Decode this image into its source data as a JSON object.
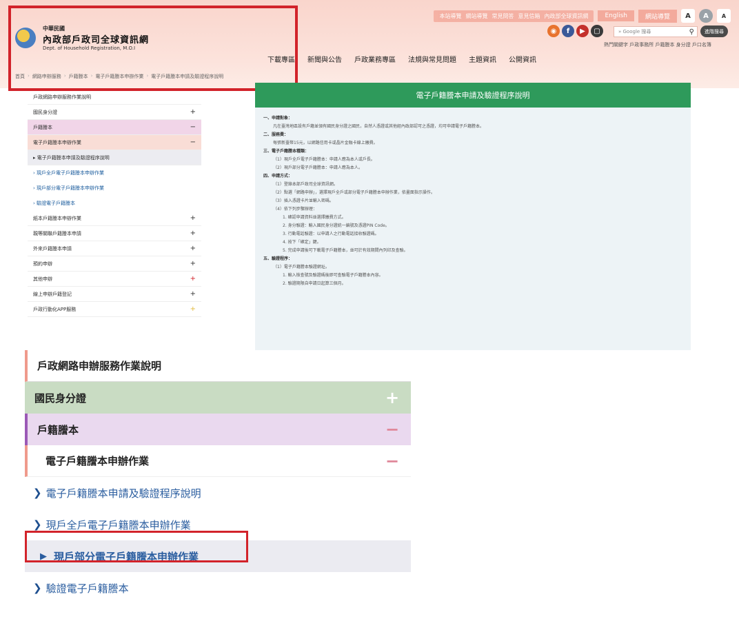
{
  "header": {
    "utility_links": [
      "本站導覽",
      "網站導覽",
      "常見問答",
      "意見信箱",
      "內政部全球資訊網"
    ],
    "lang_label": "English",
    "sitemap_label": "網站導覽",
    "font_sizes": [
      "A",
      "A",
      "A"
    ],
    "social_icons": [
      "rss-icon",
      "facebook-icon",
      "youtube-icon",
      "line-icon"
    ],
    "search_placeholder": "» Google 搜尋",
    "search_button": "進階搜尋",
    "hot_keywords": "熱門關鍵字 戶政事務所 戶籍謄本 身分證 戶口名簿"
  },
  "logo": {
    "line1": "中華民國",
    "line2": "內政部戶政司全球資訊網",
    "line3": "Dept. of Household Registration, M.O.I"
  },
  "main_nav": [
    "下載專區",
    "新聞與公告",
    "戶政業務專區",
    "法規與常見問題",
    "主題資訊",
    "公開資訊"
  ],
  "breadcrumb": [
    "首頁",
    "網路申辦服務",
    "戶籍謄本",
    "電子戶籍謄本申辦作業",
    "電子戶籍謄本申請及驗證程序說明"
  ],
  "sidebar_small": [
    {
      "label": "戶政網路申辦服務作業說明",
      "sign": "",
      "style": "plain"
    },
    {
      "label": "國民身分證",
      "sign": "+",
      "style": "plain"
    },
    {
      "label": "戶籍謄本",
      "sign": "−",
      "style": "pink"
    },
    {
      "label": "電子戶籍謄本申辦作業",
      "sign": "−",
      "style": "salmon"
    },
    {
      "label": "▸ 電子戶籍謄本申請及驗證程序說明",
      "sign": "",
      "style": "grey"
    },
    {
      "label": "› 現戶全戶電子戶籍謄本申辦作業",
      "sign": "",
      "style": "link"
    },
    {
      "label": "› 現戶部分電子戶籍謄本申辦作業",
      "sign": "",
      "style": "link"
    },
    {
      "label": "› 驗證電子戶籍謄本",
      "sign": "",
      "style": "link"
    },
    {
      "label": "紙本戶籍謄本申辦作業",
      "sign": "+",
      "style": "plain"
    },
    {
      "label": "親等關聯戶籍謄本申請",
      "sign": "+",
      "style": "plain"
    },
    {
      "label": "外來戶籍謄本申請",
      "sign": "+",
      "style": "plain"
    },
    {
      "label": "預約申辦",
      "sign": "+",
      "style": "plain"
    },
    {
      "label": "其他申辦",
      "sign": "+",
      "style": "plain"
    },
    {
      "label": "線上申辦戶籍登記",
      "sign": "+",
      "style": "plain"
    },
    {
      "label": "戶政行動化APP服務",
      "sign": "+",
      "style": "plain"
    }
  ],
  "content": {
    "title": "電子戶籍謄本申請及驗證程序說明",
    "lines": [
      {
        "text": "一、申請對象：",
        "level": 0
      },
      {
        "text": "凡在臺灣地區設有戶籍並領有國民身分證之國民，自然人憑證或其他經內政部認可之憑證，均可申請電子戶籍謄本。",
        "level": 1
      },
      {
        "text": "二、服務費：",
        "level": 0
      },
      {
        "text": "每張新臺幣15元，以網路信用卡或晶片金融卡線上繳費。",
        "level": 1
      },
      {
        "text": "三、電子戶籍謄本種類：",
        "level": 0
      },
      {
        "text": "（1）現戶全戶電子戶籍謄本：申請人應為本人或戶長。",
        "level": 1
      },
      {
        "text": "（2）現戶部分電子戶籍謄本：申請人應為本人。",
        "level": 1
      },
      {
        "text": "四、申請方式：",
        "level": 0
      },
      {
        "text": "（1）登錄本部戶政司全球資訊網。",
        "level": 1
      },
      {
        "text": "（2）點選「網路申辦」，選擇現戶全戶或部分電子戶籍謄本申辦作業，依畫面指示操作。",
        "level": 1
      },
      {
        "text": "（3）插入憑證卡片並輸入密碼。",
        "level": 1
      },
      {
        "text": "（4）依下列步驟辦理：",
        "level": 1
      },
      {
        "text": "1. 確認申請資料並選擇繳費方式。",
        "level": 2
      },
      {
        "text": "2. 身分驗證：輸入國民身分證統一編號及憑證PIN Code。",
        "level": 2
      },
      {
        "text": "3. 行動電話驗證：以申請人之行動電話接收驗證碼。",
        "level": 2
      },
      {
        "text": "4. 按下「確定」鍵。",
        "level": 2
      },
      {
        "text": "5. 完成申請後可下載電子戶籍謄本，並可於有效期間內列印及查驗。",
        "level": 2
      },
      {
        "text": "五、驗證程序：",
        "level": 0
      },
      {
        "text": "（1）電子戶籍謄本驗證網址。",
        "level": 1
      },
      {
        "text": "1. 輸入檢查號及驗證碼後即可查驗電子戶籍謄本內容。",
        "level": 2
      },
      {
        "text": "2. 驗證期限自申請日起算三個月。",
        "level": 2
      }
    ]
  },
  "sidebar_zoom": {
    "row1": "戶政網路申辦服務作業說明",
    "row2": "國民身分證",
    "row3": "戶籍謄本",
    "row4": "電子戶籍謄本申辦作業",
    "link1": "電子戶籍謄本申請及驗證程序說明",
    "link2": "現戶全戶電子戶籍謄本申辦作業",
    "link3": "現戶部分電子戶籍謄本申辦作業",
    "link4": "驗證電子戶籍謄本",
    "plus": "+",
    "minus": "−"
  },
  "colors": {
    "accent_green": "#2e9a5b",
    "highlight_red": "#d2232a",
    "link_blue": "#2a5d9f"
  }
}
